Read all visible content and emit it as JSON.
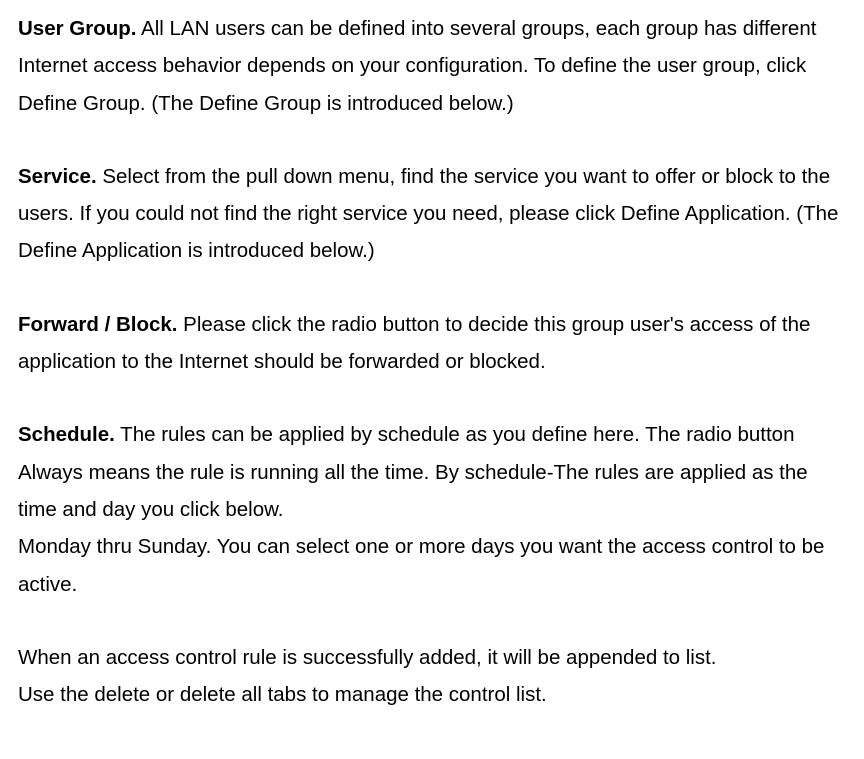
{
  "sections": {
    "userGroup": {
      "heading": "User Group.",
      "body": " All LAN users can be defined into several groups, each group has different Internet access behavior depends on your configuration. To define the user group, click Define Group. (The Define Group is introduced below.)"
    },
    "service": {
      "heading": "Service.",
      "body": " Select from the pull down menu, find the service you want to offer or block to the users. If you could not find the right service you need, please click Define Application. (The Define Application is introduced below.)"
    },
    "forwardBlock": {
      "heading": "Forward / Block.",
      "body": " Please click the radio button to decide this group user's access of the application to the Internet should be forwarded or blocked."
    },
    "schedule": {
      "heading": "Schedule.",
      "body1": " The rules can be applied by schedule as you define here. The radio button Always means the rule is running all the time. By schedule-The rules are applied as the time and day you click below.",
      "body2": "Monday thru Sunday. You can select one or more days you want the access control to be active."
    },
    "footer": {
      "line1": "When an access control rule is successfully added, it will be appended to list.",
      "line2": "Use the delete or delete all tabs to manage the control list."
    }
  }
}
